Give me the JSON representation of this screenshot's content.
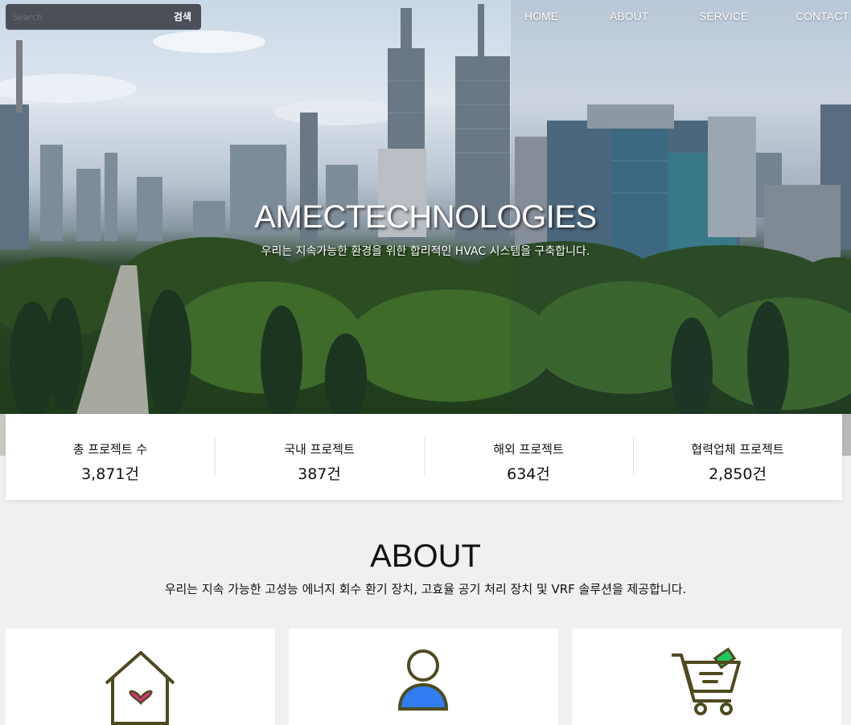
{
  "search": {
    "placeholder": "Search",
    "button_label": "검색"
  },
  "nav": {
    "items": [
      "HOME",
      "ABOUT",
      "SERVICE",
      "CONTACT"
    ]
  },
  "hero": {
    "title": "AMECTECHNOLOGIES",
    "subtitle": "우리는 지속가능한 환경을 위한 합리적인 HVAC 시스템을 구축합니다."
  },
  "stats": [
    {
      "label": "총 프로젝트 수",
      "value": "3,871건"
    },
    {
      "label": "국내 프로젝트",
      "value": "387건"
    },
    {
      "label": "해외 프로젝트",
      "value": "634건"
    },
    {
      "label": "협력업체 프로젝트",
      "value": "2,850건"
    }
  ],
  "about": {
    "title": "ABOUT",
    "description": "우리는 지속 가능한 고성능 에너지 회수 환기 장치, 고효율 공기 처리 장치 및 VRF 솔루션을 제공합니다."
  },
  "cards": [
    {
      "icon": "home-heart-icon"
    },
    {
      "icon": "user-icon"
    },
    {
      "icon": "shopping-cart-icon"
    }
  ],
  "colors": {
    "icon_outline": "#4f4a1f",
    "heart": "#e0327d",
    "user_accent": "#2f7df0",
    "cart_accent": "#22c55e"
  }
}
